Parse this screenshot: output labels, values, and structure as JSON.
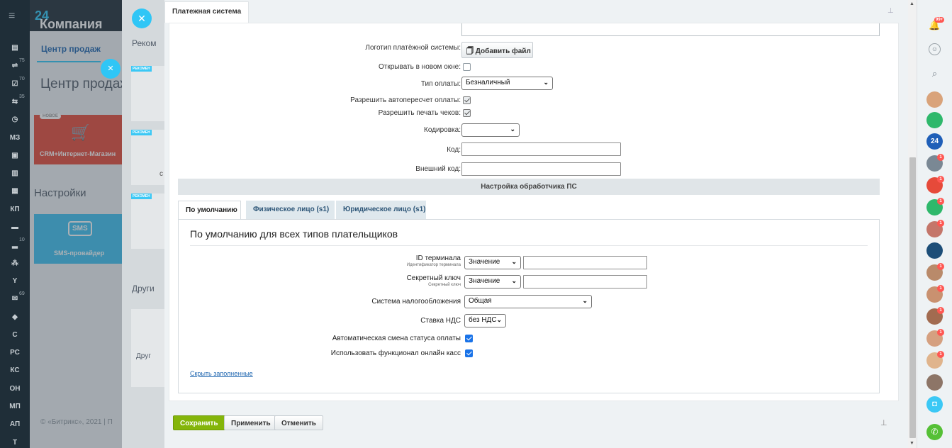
{
  "app": {
    "brand_name": "Компания",
    "brand_num": "24"
  },
  "leftnav": {
    "items": [
      {
        "icon": "▤",
        "cnt": ""
      },
      {
        "icon": "⇌",
        "cnt": "75"
      },
      {
        "icon": "☑",
        "cnt": "70"
      },
      {
        "icon": "⇆",
        "cnt": "35"
      },
      {
        "icon": "◷",
        "cnt": ""
      },
      {
        "icon": "МЗ",
        "cnt": ""
      },
      {
        "icon": "▣",
        "cnt": ""
      },
      {
        "icon": "▥",
        "cnt": ""
      },
      {
        "icon": "▦",
        "cnt": ""
      },
      {
        "icon": "КП",
        "cnt": ""
      },
      {
        "icon": "▬",
        "cnt": ""
      },
      {
        "icon": "▂",
        "cnt": "10"
      },
      {
        "icon": "⁂",
        "cnt": ""
      },
      {
        "icon": "Y",
        "cnt": ""
      },
      {
        "icon": "✉",
        "cnt": "69"
      },
      {
        "icon": "◆",
        "cnt": ""
      },
      {
        "icon": "С",
        "cnt": ""
      },
      {
        "icon": "РС",
        "cnt": ""
      },
      {
        "icon": "КС",
        "cnt": ""
      },
      {
        "icon": "ОН",
        "cnt": ""
      },
      {
        "icon": "МП",
        "cnt": ""
      },
      {
        "icon": "АП",
        "cnt": ""
      },
      {
        "icon": "Т",
        "cnt": ""
      }
    ]
  },
  "background": {
    "tab": "Центр продаж",
    "title": "Центр продаж",
    "tile1_badge": "НОВОЕ",
    "tile1_label": "CRM+Интернет-Магазин",
    "settings": "Настройки",
    "tile2_icon": "SMS",
    "tile2_label": "SMS-провайдер",
    "footer": "© «Битрикс», 2021   |   П",
    "mid_title": "Реком",
    "mid_card_tag": "РЕКОМЕН",
    "mid_other": "Други",
    "mid_other2": "Друг",
    "mid_c": "с"
  },
  "slider": {
    "title": "Платежная система"
  },
  "form": {
    "logo_label": "Логотип платёжной системы:",
    "add_file": "Добавить файл",
    "new_window_label": "Открывать в новом окне:",
    "pay_type_label": "Тип оплаты:",
    "pay_type_value": "Безналичный",
    "recalc_label": "Разрешить автопересчет оплаты:",
    "print_label": "Разрешить печать чеков:",
    "encoding_label": "Кодировка:",
    "encoding_value": "",
    "code_label": "Код:",
    "ext_code_label": "Внешний код:",
    "section_title": "Настройка обработчика ПС"
  },
  "tabs": [
    {
      "label": "По умолчанию"
    },
    {
      "label": "Физическое лицо (s1)"
    },
    {
      "label": "Юридическое лицо (s1)"
    }
  ],
  "tab_body": {
    "heading": "По умолчанию для всех типов плательщиков",
    "terminal_label": "ID терминала",
    "terminal_sub": "Идентификатор терминала",
    "terminal_type": "Значение",
    "secret_label": "Секретный ключ",
    "secret_sub": "Секретный ключ",
    "secret_type": "Значение",
    "tax_label": "Система налогообложения",
    "tax_value": "Общая",
    "vat_label": "Ставка НДС",
    "vat_value": "без НДС",
    "auto_status_label": "Автоматическая смена статуса оплаты",
    "online_kassa_label": "Использовать функционал онлайн касс",
    "hide_filled": "Скрыть заполненные"
  },
  "footer": {
    "save": "Сохранить",
    "apply": "Применить",
    "cancel": "Отменить"
  },
  "rightbar": {
    "notif_badge": "99+",
    "counter_24": "24",
    "badge": "1"
  },
  "colors": {
    "accent": "#2fc6f6",
    "save_green": "#84b50a",
    "nav_bg": "#1f2e38",
    "tile_red": "#e64a3a",
    "tile_blue": "#3ec2f1"
  }
}
